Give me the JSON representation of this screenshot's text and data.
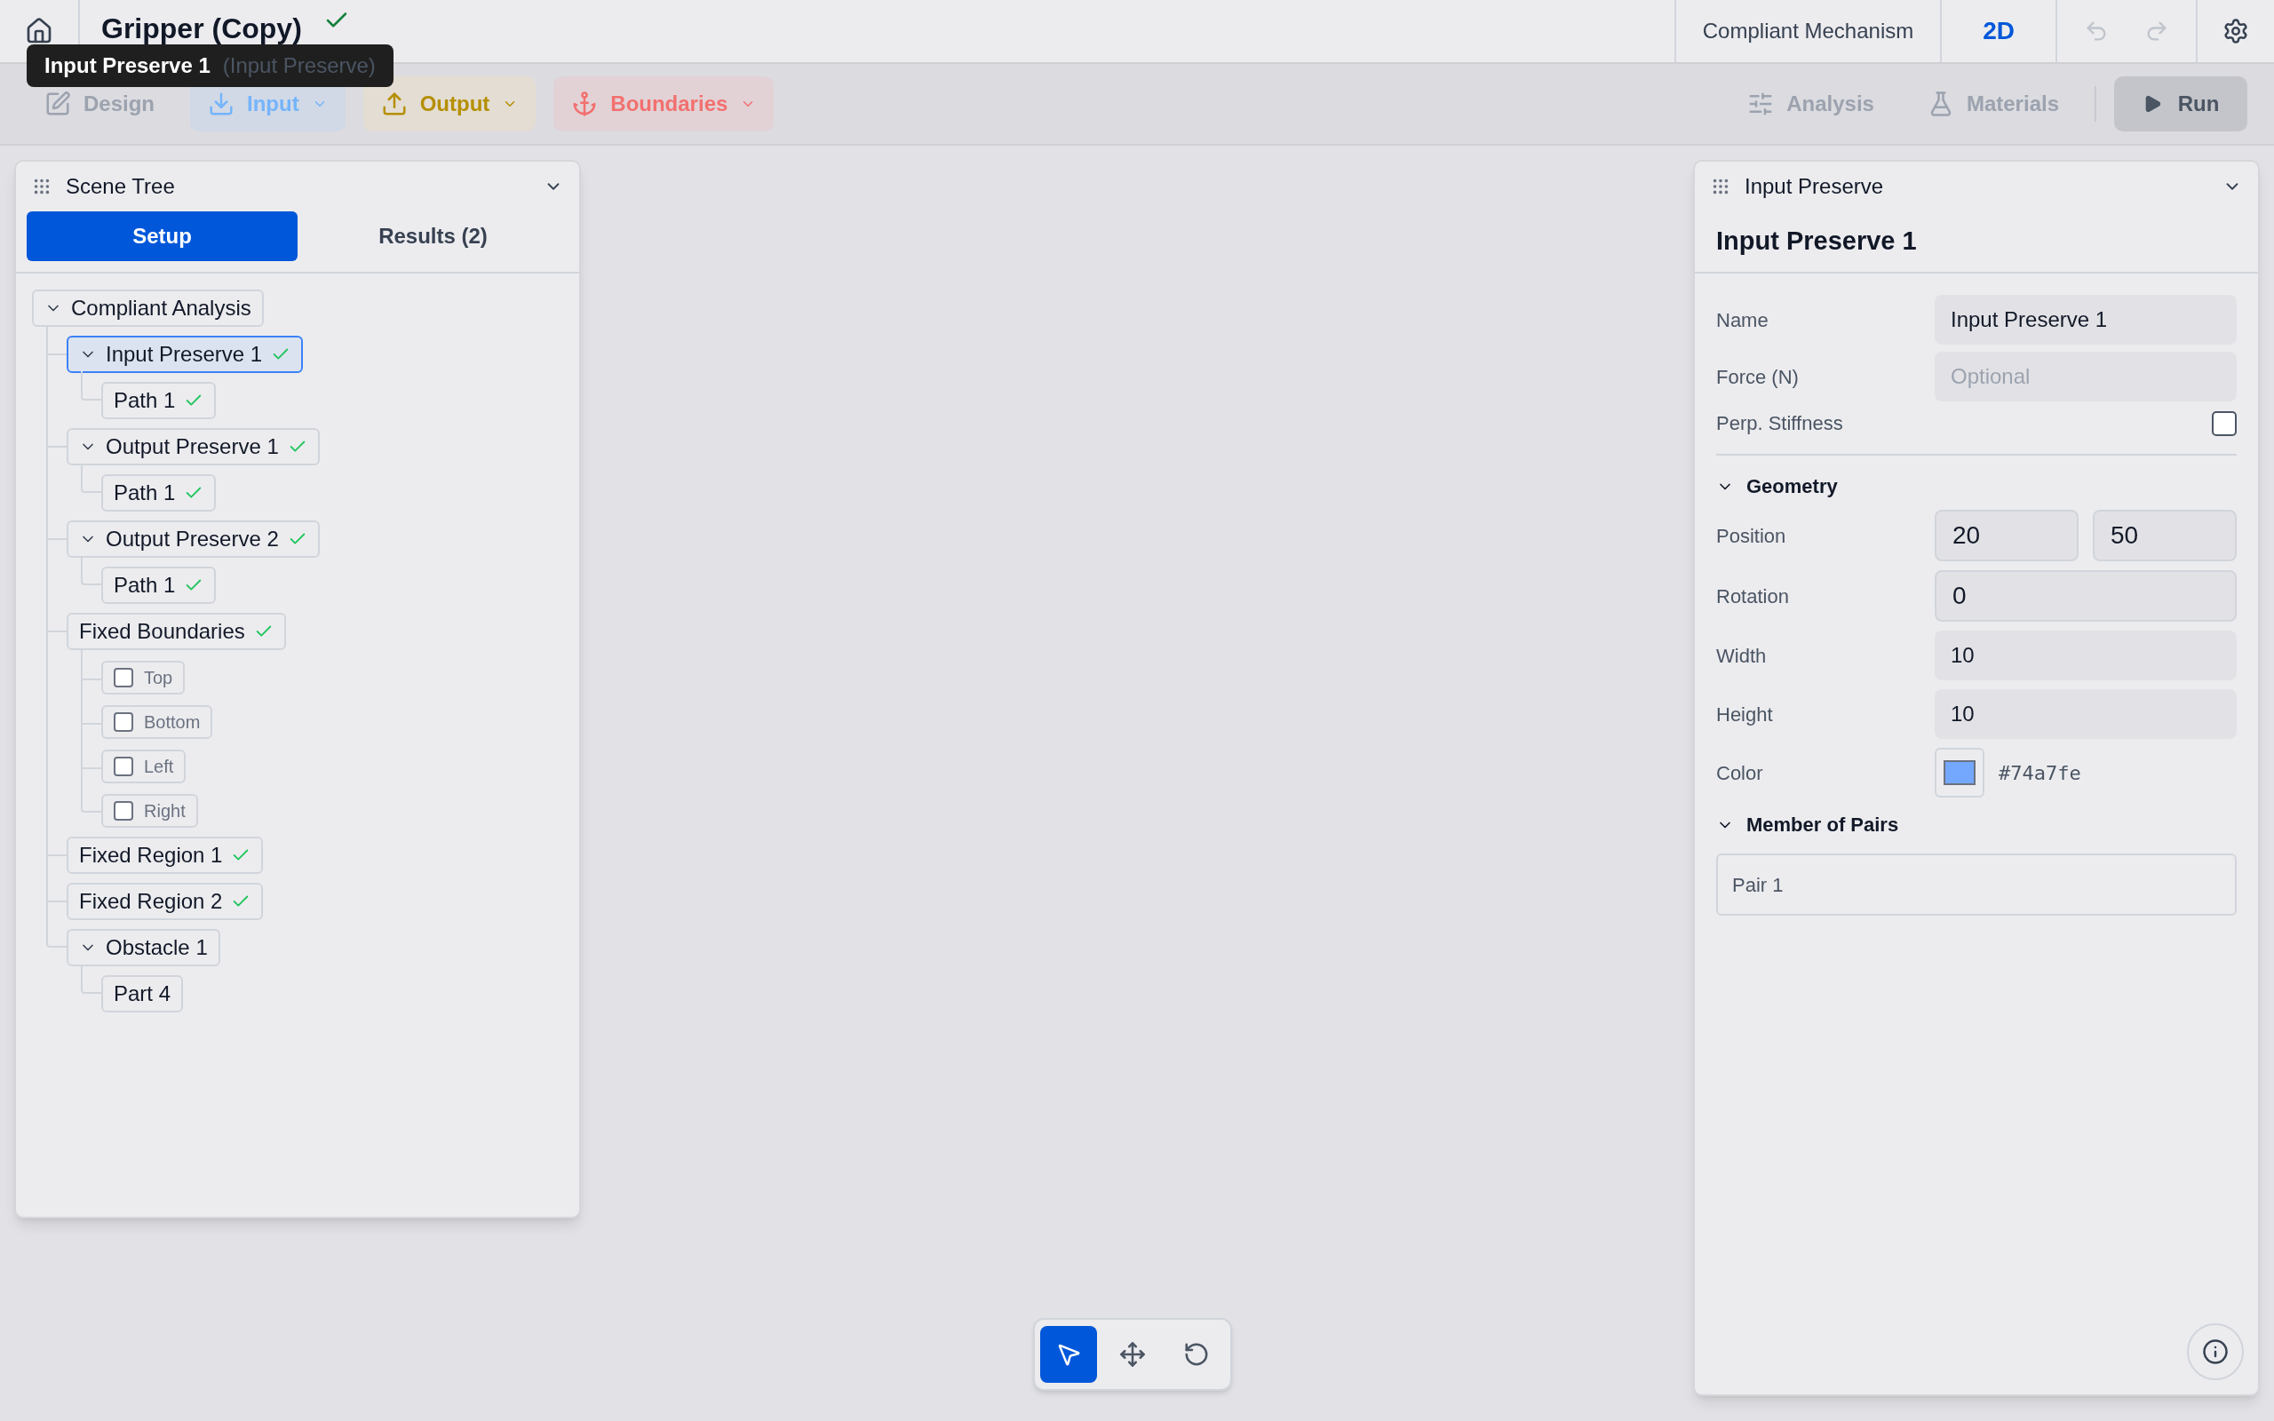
{
  "header": {
    "title": "Gripper (Copy)",
    "saved": true,
    "mode": "Compliant Mechanism",
    "view": "2D"
  },
  "tooltip": {
    "name": "Input Preserve 1",
    "type": "(Input Preserve)"
  },
  "toolbar": {
    "tools": [
      {
        "label": "Design",
        "kind": "design"
      },
      {
        "label": "Input",
        "kind": "input"
      },
      {
        "label": "Output",
        "kind": "output"
      },
      {
        "label": "Boundaries",
        "kind": "boundaries"
      }
    ],
    "actions": [
      {
        "label": "Analysis",
        "kind": "analysis"
      },
      {
        "label": "Materials",
        "kind": "materials"
      }
    ],
    "run": "Run"
  },
  "scene_tree": {
    "title": "Scene Tree",
    "tabs": [
      {
        "label": "Setup",
        "selected": true
      },
      {
        "label": "Results (2)",
        "selected": false
      }
    ],
    "items": [
      {
        "label": "Compliant Analysis",
        "kind": "node",
        "expanded": true,
        "valid": false,
        "selected": false,
        "children": [
          {
            "label": "Input Preserve 1",
            "kind": "node",
            "expanded": true,
            "valid": true,
            "selected": true,
            "children": [
              {
                "label": "Path 1",
                "kind": "node",
                "valid": true,
                "selected": false
              }
            ]
          },
          {
            "label": "Output Preserve 1",
            "kind": "node",
            "expanded": true,
            "valid": true,
            "selected": false,
            "children": [
              {
                "label": "Path 1",
                "kind": "node",
                "valid": true,
                "selected": false
              }
            ]
          },
          {
            "label": "Output Preserve 2",
            "kind": "node",
            "expanded": true,
            "valid": true,
            "selected": false,
            "children": [
              {
                "label": "Path 1",
                "kind": "node",
                "valid": true,
                "selected": false
              }
            ]
          },
          {
            "label": "Fixed Boundaries",
            "kind": "node",
            "valid": true,
            "selected": false,
            "children": [
              {
                "label": "Top",
                "kind": "checkbox",
                "checked": false
              },
              {
                "label": "Bottom",
                "kind": "checkbox",
                "checked": false
              },
              {
                "label": "Left",
                "kind": "checkbox",
                "checked": false
              },
              {
                "label": "Right",
                "kind": "checkbox",
                "checked": false
              }
            ]
          },
          {
            "label": "Fixed Region 1",
            "kind": "node",
            "valid": true,
            "selected": false
          },
          {
            "label": "Fixed Region 2",
            "kind": "node",
            "valid": true,
            "selected": false
          },
          {
            "label": "Obstacle 1",
            "kind": "node",
            "expanded": true,
            "valid": false,
            "selected": false,
            "children": [
              {
                "label": "Part 4",
                "kind": "node",
                "valid": false,
                "selected": false
              }
            ]
          }
        ]
      }
    ]
  },
  "properties": {
    "panel_title": "Input Preserve",
    "heading": "Input Preserve 1",
    "fields": [
      {
        "label": "Name",
        "kind": "text",
        "value": "Input Preserve 1"
      },
      {
        "label": "Force (N)",
        "kind": "text",
        "placeholder": "Optional"
      },
      {
        "label": "Perp. Stiffness",
        "kind": "checkbox",
        "checked": false
      }
    ],
    "geometry": {
      "title": "Geometry",
      "expanded": true,
      "fields": [
        {
          "label": "Position",
          "kind": "pair",
          "values": [
            "20",
            "50"
          ]
        },
        {
          "label": "Rotation",
          "kind": "boxed",
          "value": "0"
        },
        {
          "label": "Width",
          "kind": "text",
          "value": "10"
        },
        {
          "label": "Height",
          "kind": "text",
          "value": "10"
        },
        {
          "label": "Color",
          "kind": "color",
          "color": "#74a7fe",
          "value": "#74a7fe"
        }
      ]
    },
    "pairs": {
      "title": "Member of Pairs",
      "expanded": true,
      "items": [
        "Pair 1"
      ]
    }
  },
  "canvas_tools": [
    {
      "kind": "select",
      "selected": true
    },
    {
      "kind": "move",
      "selected": false
    },
    {
      "kind": "rotate",
      "selected": false
    }
  ]
}
